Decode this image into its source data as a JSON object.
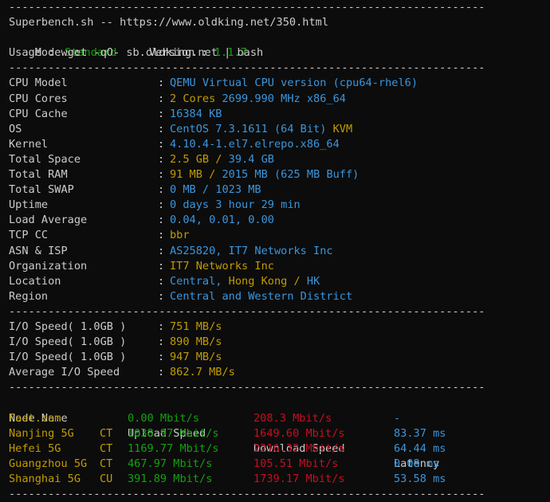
{
  "separator": "-------------------------------------------------------------------------",
  "header": {
    "title": "Superbench.sh -- https://www.oldking.net/350.html",
    "mode_label": "Mode  :",
    "mode_value": "Standard",
    "version_label": "Version :",
    "version_value": "1.1.7",
    "usage": "Usage : wget -qO- sb.oldking.net | bash"
  },
  "sysinfo": [
    {
      "key": "CPU Model",
      "parts": [
        {
          "text": "QEMU Virtual CPU version (cpu64-rhel6)",
          "color": "cyan"
        }
      ]
    },
    {
      "key": "CPU Cores",
      "parts": [
        {
          "text": "2 Cores ",
          "color": "yellow"
        },
        {
          "text": "2699.990 MHz x86_64",
          "color": "cyan"
        }
      ]
    },
    {
      "key": "CPU Cache",
      "parts": [
        {
          "text": "16384 KB",
          "color": "cyan"
        }
      ]
    },
    {
      "key": "OS",
      "parts": [
        {
          "text": "CentOS 7.3.1611 (64 Bit) ",
          "color": "cyan"
        },
        {
          "text": "KVM",
          "color": "yellow"
        }
      ]
    },
    {
      "key": "Kernel",
      "parts": [
        {
          "text": "4.10.4-1.el7.elrepo.x86_64",
          "color": "cyan"
        }
      ]
    },
    {
      "key": "Total Space",
      "parts": [
        {
          "text": "2.5 GB / ",
          "color": "yellow"
        },
        {
          "text": "39.4 GB",
          "color": "cyan"
        }
      ]
    },
    {
      "key": "Total RAM",
      "parts": [
        {
          "text": "91 MB / ",
          "color": "yellow"
        },
        {
          "text": "2015 MB",
          "color": "cyan"
        },
        {
          "text": " (625 MB Buff)",
          "color": "cyan"
        }
      ]
    },
    {
      "key": "Total SWAP",
      "parts": [
        {
          "text": "0 MB / 1023 MB",
          "color": "cyan"
        }
      ]
    },
    {
      "key": "Uptime",
      "parts": [
        {
          "text": "0 days 3 hour 29 min",
          "color": "cyan"
        }
      ]
    },
    {
      "key": "Load Average",
      "parts": [
        {
          "text": "0.04, 0.01, 0.00",
          "color": "cyan"
        }
      ]
    },
    {
      "key": "TCP CC",
      "parts": [
        {
          "text": "bbr",
          "color": "yellow"
        }
      ]
    },
    {
      "key": "ASN & ISP",
      "parts": [
        {
          "text": "AS25820, IT7 Networks Inc",
          "color": "cyan"
        }
      ]
    },
    {
      "key": "Organization",
      "parts": [
        {
          "text": "IT7 Networks Inc",
          "color": "yellow"
        }
      ]
    },
    {
      "key": "Location",
      "parts": [
        {
          "text": "Central, ",
          "color": "cyan"
        },
        {
          "text": "Hong Kong / ",
          "color": "yellow"
        },
        {
          "text": "HK",
          "color": "cyan"
        }
      ]
    },
    {
      "key": "Region",
      "parts": [
        {
          "text": "Central and Western District",
          "color": "cyan"
        }
      ]
    }
  ],
  "io": [
    {
      "key": "I/O Speed( 1.0GB )",
      "value": "751 MB/s"
    },
    {
      "key": "I/O Speed( 1.0GB )",
      "value": "890 MB/s"
    },
    {
      "key": "I/O Speed( 1.0GB )",
      "value": "947 MB/s"
    },
    {
      "key": "Average I/O Speed",
      "value": "862.7 MB/s"
    }
  ],
  "speedtest": {
    "headers": {
      "name": "Node Name",
      "upload": "Upload Speed",
      "download": "Download Speed",
      "latency": "Latency"
    },
    "rows": [
      {
        "name": "Fast.com",
        "isp": "",
        "upload": "0.00 Mbit/s",
        "download": "208.3 Mbit/s",
        "latency": "-"
      },
      {
        "name": "Nanjing 5G",
        "isp": "CT",
        "upload": "1038.97 Mbit/s",
        "download": "1649.60 Mbit/s",
        "latency": "83.37 ms"
      },
      {
        "name": "Hefei 5G",
        "isp": "CT",
        "upload": "1169.77 Mbit/s",
        "download": "2216.32 Mbit/s",
        "latency": "64.44 ms"
      },
      {
        "name": "Guangzhou 5G",
        "isp": "CT",
        "upload": "467.97 Mbit/s",
        "download": "105.51 Mbit/s",
        "latency": "0.08 ms"
      },
      {
        "name": "Shanghai 5G",
        "isp": "CU",
        "upload": "391.89 Mbit/s",
        "download": "1739.17 Mbit/s",
        "latency": "53.58 ms"
      }
    ]
  },
  "colors": {
    "background": "#0c0c0c",
    "text": "#cccccc",
    "cyan": "#3a96dd",
    "yellow": "#c19c00",
    "green": "#13a10e",
    "red": "#c50f1f"
  }
}
